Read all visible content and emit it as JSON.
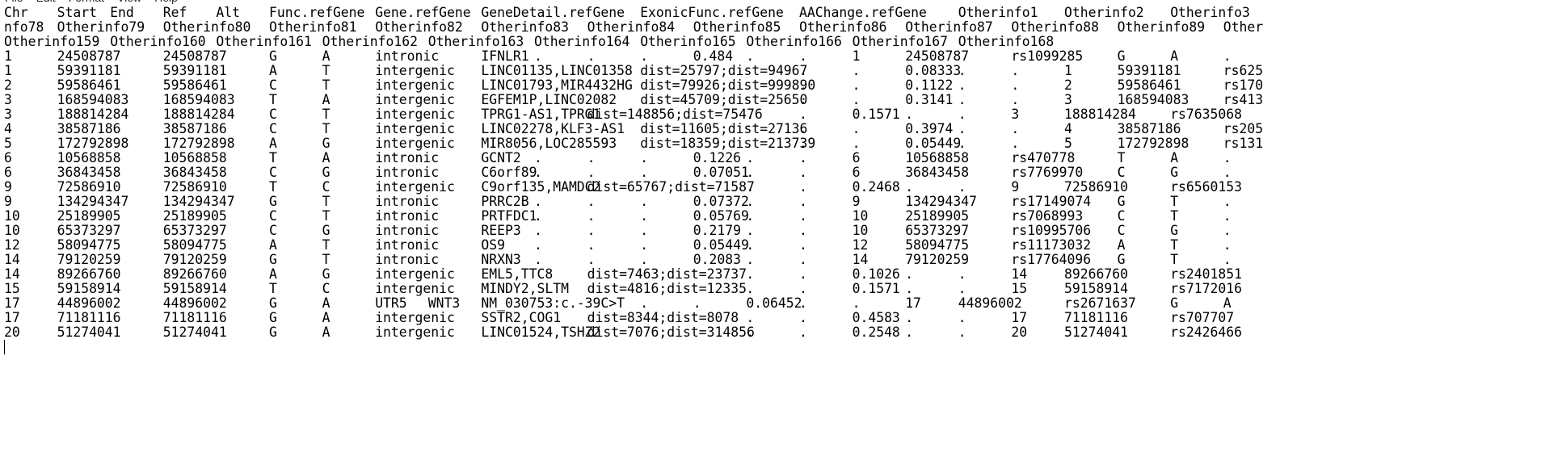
{
  "menu": [
    "File",
    "Edit",
    "Format",
    "View",
    "Help"
  ],
  "header1": [
    "Chr",
    "Start",
    "End",
    "Ref",
    "Alt",
    "Func.refGene",
    "Gene.refGene",
    "GeneDetail.refGene",
    "ExonicFunc.refGene",
    "AAChange.refGene",
    "Otherinfo1",
    "Otherinfo2",
    "Otherinfo3"
  ],
  "header2": [
    "nfo78",
    "Otherinfo79",
    "Otherinfo80",
    "Otherinfo81",
    "Otherinfo82",
    "Otherinfo83",
    "Otherinfo84",
    "Otherinfo85",
    "Otherinfo86",
    "Otherinfo87",
    "Otherinfo88",
    "Otherinfo89",
    "Other"
  ],
  "header3": [
    "Otherinfo159",
    "Otherinfo160",
    "Otherinfo161",
    "Otherinfo162",
    "Otherinfo163",
    "Otherinfo164",
    "Otherinfo165",
    "Otherinfo166",
    "Otherinfo167",
    "Otherinfo168"
  ],
  "rows": [
    [
      "1",
      "24508787",
      "24508787",
      "G",
      "A",
      "intronic",
      "IFNLR1",
      ".",
      ".",
      ".",
      "0.484",
      ".",
      ".",
      "1",
      "24508787",
      "rs1099285",
      "G",
      "A",
      "."
    ],
    [
      "1",
      "59391181",
      "59391181",
      "A",
      "T",
      "intergenic",
      "LINC01135,LINC01358",
      "dist=25797;dist=94967",
      ".",
      ".",
      "0.08333",
      ".",
      ".",
      "1",
      "59391181",
      "rs625"
    ],
    [
      "2",
      "59586461",
      "59586461",
      "C",
      "T",
      "intergenic",
      "LINC01793,MIR4432HG",
      "dist=79926;dist=999890",
      ".",
      ".",
      "0.1122",
      ".",
      ".",
      "2",
      "59586461",
      "rs170"
    ],
    [
      "3",
      "168594083",
      "168594083",
      "T",
      "A",
      "intergenic",
      "EGFEM1P,LINC02082",
      "dist=45709;dist=25650",
      ".",
      ".",
      "0.3141",
      ".",
      ".",
      "3",
      "168594083",
      "rs413"
    ],
    [
      "3",
      "188814284",
      "188814284",
      "C",
      "T",
      "intergenic",
      "TPRG1-AS1,TPRG1",
      "dist=148856;dist=75476",
      ".",
      ".",
      "0.1571",
      ".",
      ".",
      "3",
      "188814284",
      "rs7635068"
    ],
    [
      "4",
      "38587186",
      "38587186",
      "C",
      "T",
      "intergenic",
      "LINC02278,KLF3-AS1",
      "dist=11605;dist=27136",
      ".",
      ".",
      "0.3974",
      ".",
      ".",
      "4",
      "38587186",
      "rs205"
    ],
    [
      "5",
      "172792898",
      "172792898",
      "A",
      "G",
      "intergenic",
      "MIR8056,LOC285593",
      "dist=18359;dist=213739",
      ".",
      ".",
      "0.05449",
      ".",
      ".",
      "5",
      "172792898",
      "rs131"
    ],
    [
      "6",
      "10568858",
      "10568858",
      "T",
      "A",
      "intronic",
      "GCNT2",
      ".",
      ".",
      ".",
      "0.1226",
      ".",
      ".",
      "6",
      "10568858",
      "rs470778",
      "T",
      "A",
      "."
    ],
    [
      "6",
      "36843458",
      "36843458",
      "C",
      "G",
      "intronic",
      "C6orf89",
      ".",
      ".",
      ".",
      "0.07051",
      ".",
      ".",
      "6",
      "36843458",
      "rs7769970",
      "C",
      "G",
      "."
    ],
    [
      "9",
      "72586910",
      "72586910",
      "T",
      "C",
      "intergenic",
      "C9orf135,MAMDC2",
      "dist=65767;dist=71587",
      ".",
      ".",
      "0.2468",
      ".",
      ".",
      "9",
      "72586910",
      "rs6560153"
    ],
    [
      "9",
      "134294347",
      "134294347",
      "G",
      "T",
      "intronic",
      "PRRC2B",
      ".",
      ".",
      ".",
      "0.07372",
      ".",
      ".",
      "9",
      "134294347",
      "rs17149074",
      "G",
      "T",
      "."
    ],
    [
      "10",
      "25189905",
      "25189905",
      "C",
      "T",
      "intronic",
      "PRTFDC1",
      ".",
      ".",
      ".",
      "0.05769",
      ".",
      ".",
      "10",
      "25189905",
      "rs7068993",
      "C",
      "T",
      "."
    ],
    [
      "10",
      "65373297",
      "65373297",
      "C",
      "G",
      "intronic",
      "REEP3",
      ".",
      ".",
      ".",
      "0.2179",
      ".",
      ".",
      "10",
      "65373297",
      "rs10995706",
      "C",
      "G",
      "."
    ],
    [
      "12",
      "58094775",
      "58094775",
      "A",
      "T",
      "intronic",
      "OS9",
      ".",
      ".",
      ".",
      "0.05449",
      ".",
      ".",
      "12",
      "58094775",
      "rs11173032",
      "A",
      "T",
      "."
    ],
    [
      "14",
      "79120259",
      "79120259",
      "G",
      "T",
      "intronic",
      "NRXN3",
      ".",
      ".",
      ".",
      "0.2083",
      ".",
      ".",
      "14",
      "79120259",
      "rs17764096",
      "G",
      "T",
      "."
    ],
    [
      "14",
      "89266760",
      "89266760",
      "A",
      "G",
      "intergenic",
      "EML5,TTC8",
      "dist=7463;dist=23737",
      ".",
      ".",
      "0.1026",
      ".",
      ".",
      "14",
      "89266760",
      "rs2401851"
    ],
    [
      "15",
      "59158914",
      "59158914",
      "T",
      "C",
      "intergenic",
      "MINDY2,SLTM",
      "dist=4816;dist=12335",
      ".",
      ".",
      "0.1571",
      ".",
      ".",
      "15",
      "59158914",
      "rs7172016"
    ],
    [
      "17",
      "44896002",
      "44896002",
      "G",
      "A",
      "UTR5",
      "WNT3",
      "NM_030753:c.-39C>T",
      ".",
      ".",
      "0.06452",
      ".",
      ".",
      "17",
      "44896002",
      "rs2671637",
      "G",
      "A"
    ],
    [
      "17",
      "71181116",
      "71181116",
      "G",
      "A",
      "intergenic",
      "SSTR2,COG1",
      "dist=8344;dist=8078",
      ".",
      ".",
      "0.4583",
      ".",
      ".",
      "17",
      "71181116",
      "rs707707"
    ],
    [
      "20",
      "51274041",
      "51274041",
      "G",
      "A",
      "intergenic",
      "LINC01524,TSHZ2",
      "dist=7076;dist=314856",
      ".",
      ".",
      "0.2548",
      ".",
      ".",
      "20",
      "51274041",
      "rs2426466"
    ]
  ]
}
